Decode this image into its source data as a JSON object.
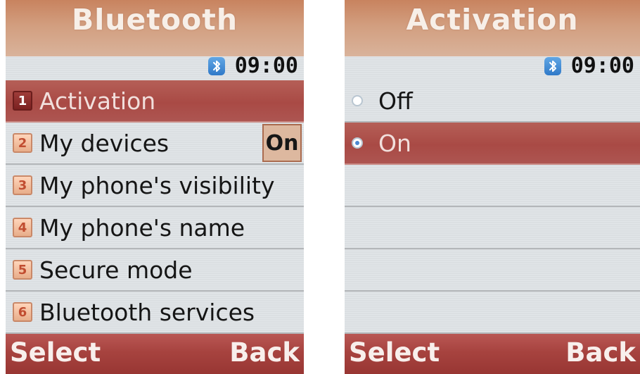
{
  "screens": [
    {
      "title": "Bluetooth",
      "status_time": "09:00",
      "menu": [
        {
          "number": "1",
          "label": "Activation",
          "selected": true
        },
        {
          "number": "2",
          "label": "My devices",
          "value": "On"
        },
        {
          "number": "3",
          "label": "My phone's visibility"
        },
        {
          "number": "4",
          "label": "My phone's name"
        },
        {
          "number": "5",
          "label": "Secure mode"
        },
        {
          "number": "6",
          "label": "Bluetooth services"
        }
      ],
      "softkeys": {
        "left": "Select",
        "right": "Back"
      }
    },
    {
      "title": "Activation",
      "status_time": "09:00",
      "options": [
        {
          "label": "Off",
          "selected": false
        },
        {
          "label": "On",
          "selected": true
        }
      ],
      "softkeys": {
        "left": "Select",
        "right": "Back"
      }
    }
  ],
  "colors": {
    "title_bar": "#d29e7f",
    "selection": "#ad5551",
    "bottom_bar": "#a7433f",
    "bluetooth_icon": "#2f79c8"
  },
  "icons": {
    "status": "bluetooth-icon",
    "radio_unselected": "radio-off-icon",
    "radio_selected": "radio-on-icon"
  }
}
